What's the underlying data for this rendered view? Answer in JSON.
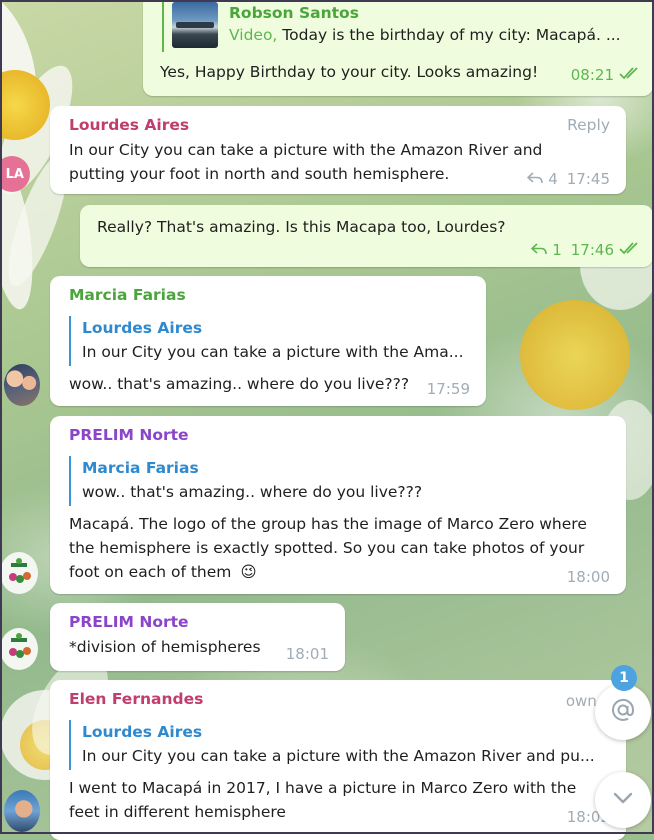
{
  "colors": {
    "outgoing_bubble": "#effdde",
    "incoming_bubble": "#ffffff",
    "sender_lourdes": "#c03d6d",
    "sender_marcia": "#4aa53c",
    "sender_prelim": "#8a45c9",
    "sender_elen": "#c03d6d",
    "reply_accent": "#3a93d5",
    "check_marks": "#5db750",
    "badge": "#4ca3df"
  },
  "messages": [
    {
      "id": "m1",
      "direction": "out",
      "reply": {
        "name": "Robson Santos",
        "prefix": "Video,",
        "text": " Today is the birthday of my city: Macapá. ..."
      },
      "lines": [
        "Yes, Happy Birthday to your city. Looks amazing!"
      ],
      "time": "08:21",
      "status_icon": "double-check-icon"
    },
    {
      "id": "m2",
      "direction": "in",
      "sender": "Lourdes Aires",
      "action": "Reply",
      "lines": [
        "In our City you can take a picture with the Amazon River and",
        "putting your foot in north and south hemisphere."
      ],
      "reply_count": "4",
      "time": "17:45",
      "avatar_initials": "LA"
    },
    {
      "id": "m3",
      "direction": "out",
      "lines": [
        "Really? That's amazing. Is this Macapa too, Lourdes?"
      ],
      "reply_count": "1",
      "time": "17:46",
      "status_icon": "double-check-icon"
    },
    {
      "id": "m4",
      "direction": "in",
      "sender": "Marcia Farias",
      "reply": {
        "name": "Lourdes Aires",
        "text": "In our City you can take a picture with the Ama..."
      },
      "lines": [
        "wow.. that's amazing.. where do you live???"
      ],
      "time": "17:59"
    },
    {
      "id": "m5",
      "direction": "in",
      "sender": "PRELIM Norte",
      "reply": {
        "name": "Marcia Farias",
        "text": "wow.. that's amazing.. where do you live???"
      },
      "lines": [
        "Macapá. The logo of the group has the image of Marco Zero where",
        "the hemisphere is exactly spotted. So you can take photos of your",
        "foot on each of them"
      ],
      "emoji": "😉",
      "time": "18:00"
    },
    {
      "id": "m6",
      "direction": "in",
      "sender": "PRELIM Norte",
      "lines": [
        "*division of hemispheres"
      ],
      "time": "18:01"
    },
    {
      "id": "m7",
      "direction": "in",
      "sender": "Elen Fernandes",
      "role": "owne",
      "reply": {
        "name": "Lourdes Aires",
        "text": "In our City you can take a picture with the Amazon River and pu..."
      },
      "lines": [
        "I went to Macapá in 2017, I have a picture in Marco Zero with the",
        "feet in  different hemisphere"
      ],
      "time": "18:02"
    }
  ],
  "floating": {
    "mentions_badge": "1",
    "mentions_icon": "at-sign-icon",
    "scroll_down_icon": "chevron-down-icon"
  }
}
